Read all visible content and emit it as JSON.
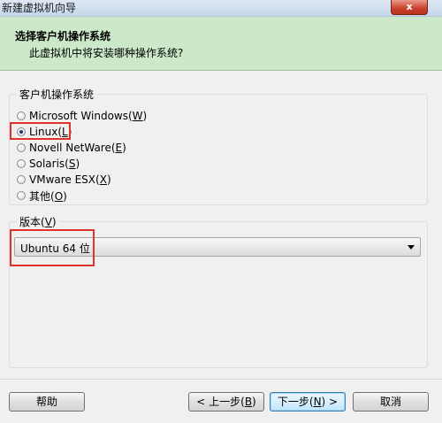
{
  "window": {
    "title": "新建虚拟机向导",
    "close_label": "x"
  },
  "header": {
    "title": "选择客户机操作系统",
    "subtitle": "此虚拟机中将安装哪种操作系统?"
  },
  "os_group": {
    "legend": "客户机操作系统",
    "options": [
      {
        "label": "Microsoft Windows(",
        "key": "W",
        "suffix": ")",
        "selected": false
      },
      {
        "label": "Linux(",
        "key": "L",
        "suffix": ")",
        "selected": true
      },
      {
        "label": "Novell NetWare(",
        "key": "E",
        "suffix": ")",
        "selected": false
      },
      {
        "label": "Solaris(",
        "key": "S",
        "suffix": ")",
        "selected": false
      },
      {
        "label": "VMware ESX(",
        "key": "X",
        "suffix": ")",
        "selected": false
      },
      {
        "label": "其他(",
        "key": "O",
        "suffix": ")",
        "selected": false
      }
    ]
  },
  "version_group": {
    "legend_prefix": "版本(",
    "legend_key": "V",
    "legend_suffix": ")",
    "selected_value": "Ubuntu 64 位"
  },
  "buttons": {
    "help": "帮助",
    "back_prefix": "< 上一步(",
    "back_key": "B",
    "back_suffix": ")",
    "next_prefix": "下一步(",
    "next_key": "N",
    "next_suffix": ") >",
    "cancel": "取消"
  },
  "colors": {
    "header_bg": "#cbe8c9",
    "highlight": "#e0342b",
    "close_button": "#c9402b"
  }
}
